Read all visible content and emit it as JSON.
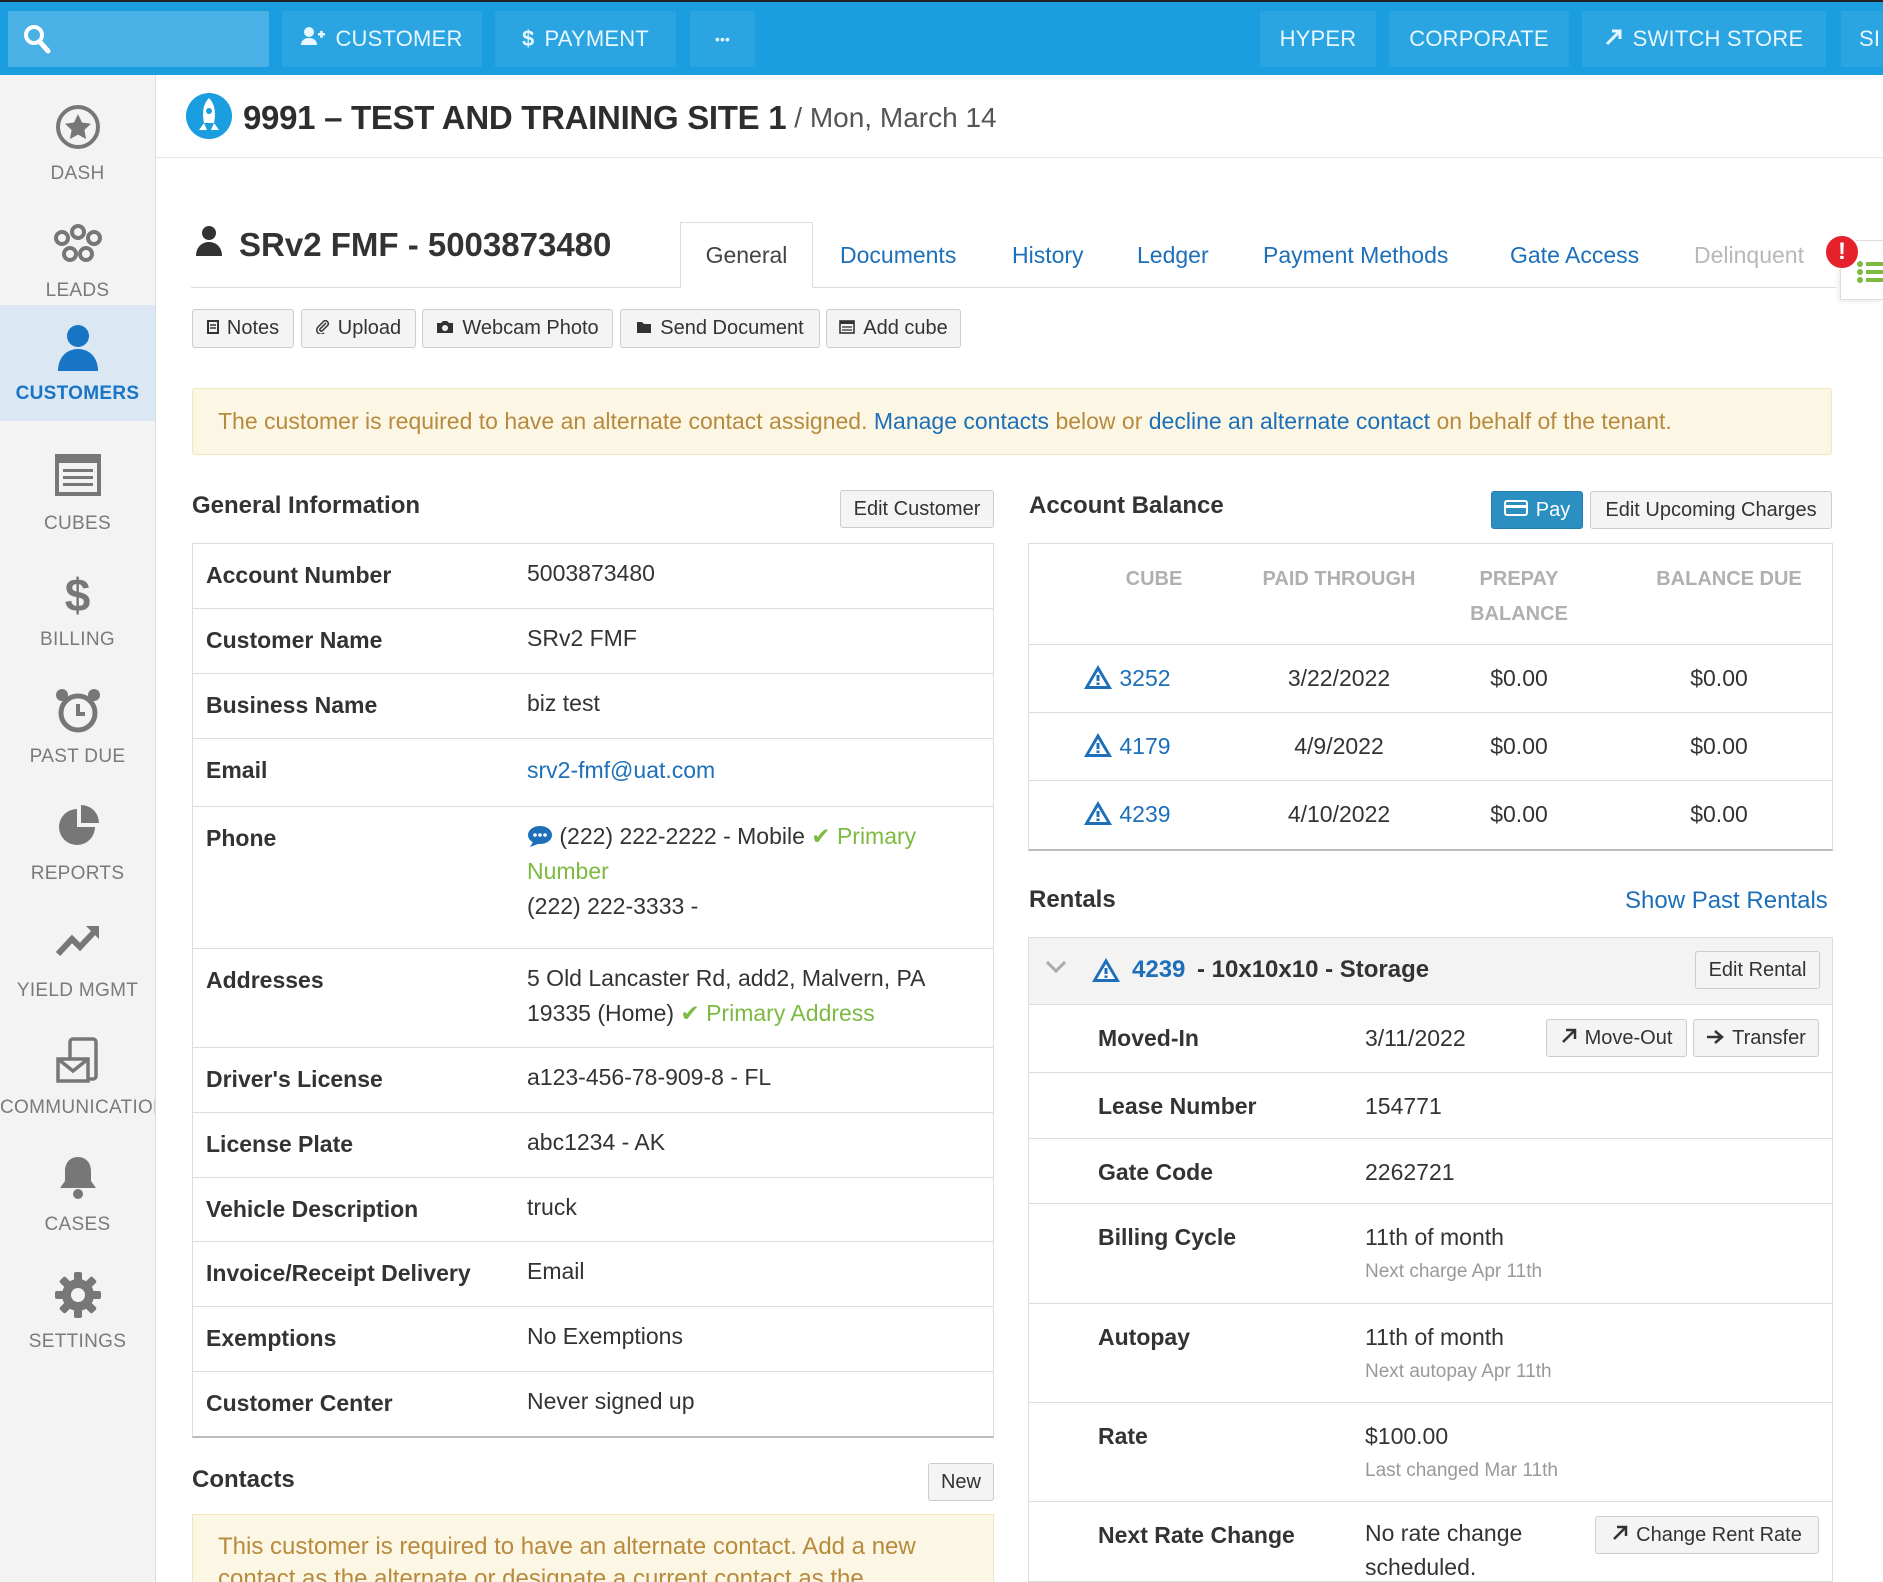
{
  "topbar": {
    "customer_label": "CUSTOMER",
    "payment_label": "PAYMENT",
    "more_label": "•••",
    "hyper_label": "HYPER",
    "corporate_label": "CORPORATE",
    "switch_store_label": "SWITCH STORE",
    "cut_label": "SI"
  },
  "sidebar": {
    "items": [
      {
        "label": "DASH",
        "icon": "star-icon"
      },
      {
        "label": "LEADS",
        "icon": "network-icon"
      },
      {
        "label": "CUSTOMERS",
        "icon": "user-icon"
      },
      {
        "label": "CUBES",
        "icon": "list-icon"
      },
      {
        "label": "BILLING",
        "icon": "dollar-icon"
      },
      {
        "label": "PAST DUE",
        "icon": "alarm-icon"
      },
      {
        "label": "REPORTS",
        "icon": "pie-icon"
      },
      {
        "label": "YIELD MGMT",
        "icon": "trend-icon"
      },
      {
        "label": "COMMUNICATIONS",
        "icon": "mail-icon"
      },
      {
        "label": "CASES",
        "icon": "bell-icon"
      },
      {
        "label": "SETTINGS",
        "icon": "gear-icon"
      }
    ]
  },
  "header": {
    "site": "9991 – TEST AND TRAINING SITE 1",
    "date": "/ Mon, March 14"
  },
  "customer": {
    "title": "SRv2 FMF - 5003873480"
  },
  "tabs": [
    "General",
    "Documents",
    "History",
    "Ledger",
    "Payment Methods",
    "Gate Access",
    "Delinquent"
  ],
  "alert_count": "!",
  "actions": {
    "notes": "Notes",
    "upload": "Upload",
    "webcam": "Webcam Photo",
    "send_document": "Send Document",
    "add_cube": "Add cube"
  },
  "warning": {
    "text1": "The customer is required to have an alternate contact assigned.",
    "link1": "Manage contacts",
    "text2": "below or",
    "link2": "decline an alternate contact",
    "text3": "on behalf of the tenant."
  },
  "general": {
    "title": "General Information",
    "edit_label": "Edit Customer",
    "rows": {
      "account_number": {
        "k": "Account Number",
        "v": "5003873480"
      },
      "customer_name": {
        "k": "Customer Name",
        "v": "SRv2 FMF"
      },
      "business_name": {
        "k": "Business Name",
        "v": "biz test"
      },
      "email": {
        "k": "Email",
        "v": "srv2-fmf@uat.com"
      },
      "phone": {
        "k": "Phone",
        "v1": "(222) 222-2222 - Mobile",
        "primary": "Primary Number",
        "v2": "(222) 222-3333 -"
      },
      "addresses": {
        "k": "Addresses",
        "v": "5 Old Lancaster Rd, add2, Malvern, PA 19335 (Home)",
        "primary": "Primary Address"
      },
      "license": {
        "k": "Driver's License",
        "v": "a123-456-78-909-8 - FL"
      },
      "plate": {
        "k": "License Plate",
        "v": "abc1234 - AK"
      },
      "vehicle": {
        "k": "Vehicle Description",
        "v": "truck"
      },
      "delivery": {
        "k": "Invoice/Receipt Delivery",
        "v": "Email"
      },
      "exemptions": {
        "k": "Exemptions",
        "v": "No Exemptions"
      },
      "center": {
        "k": "Customer Center",
        "v": "Never signed up"
      }
    }
  },
  "balance": {
    "title": "Account Balance",
    "pay_label": "Pay",
    "edit_charges_label": "Edit Upcoming Charges",
    "headers": {
      "cube": "CUBE",
      "paid": "PAID THROUGH",
      "prepay": "PREPAY BALANCE",
      "due": "BALANCE DUE"
    },
    "rows": [
      {
        "cube": "3252",
        "paid": "3/22/2022",
        "prepay": "$0.00",
        "due": "$0.00"
      },
      {
        "cube": "4179",
        "paid": "4/9/2022",
        "prepay": "$0.00",
        "due": "$0.00"
      },
      {
        "cube": "4239",
        "paid": "4/10/2022",
        "prepay": "$0.00",
        "due": "$0.00"
      }
    ]
  },
  "rentals": {
    "title": "Rentals",
    "past_label": "Show Past Rentals",
    "unit": "4239",
    "unit_desc": "- 10x10x10 - Storage",
    "edit_label": "Edit Rental",
    "moveout_label": "Move-Out",
    "transfer_label": "Transfer",
    "change_rate_label": "Change Rent Rate",
    "rows": {
      "moved_in": {
        "k": "Moved-In",
        "v": "3/11/2022"
      },
      "lease": {
        "k": "Lease Number",
        "v": "154771"
      },
      "gate": {
        "k": "Gate Code",
        "v": "2262721"
      },
      "billing": {
        "k": "Billing Cycle",
        "v": "11th of month",
        "sub": "Next charge Apr 11th"
      },
      "autopay": {
        "k": "Autopay",
        "v": "11th of month",
        "sub": "Next autopay Apr 11th"
      },
      "rate": {
        "k": "Rate",
        "v": "$100.00",
        "sub": "Last changed Mar 11th"
      },
      "next_rate": {
        "k": "Next Rate Change",
        "v": "No rate change scheduled."
      }
    }
  },
  "contacts": {
    "title": "Contacts",
    "new_label": "New",
    "warning": "This customer is required to have an alternate contact. Add a new contact as the alternate or designate a current contact as the alternate."
  },
  "colors": {
    "brand": "#1a9ee0",
    "link": "#1c6fb8",
    "green": "#7cba40",
    "warn_bg": "#fcf7e4"
  }
}
